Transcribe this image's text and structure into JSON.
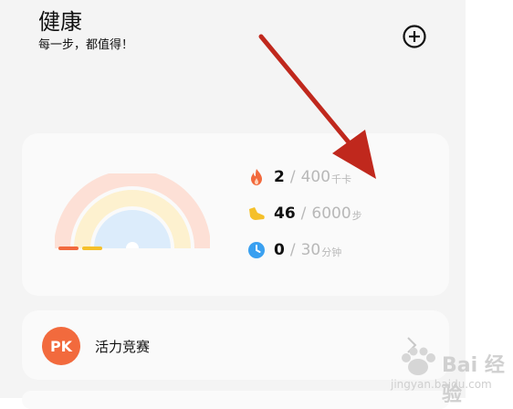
{
  "header": {
    "title": "健康",
    "subtitle": "每一步，都值得！"
  },
  "stats": [
    {
      "icon": "flame-icon",
      "value": "2",
      "separator": "/",
      "target": "400",
      "unit": "千卡",
      "color": "#f26a3d"
    },
    {
      "icon": "shoe-icon",
      "value": "46",
      "separator": "/",
      "target": "6000",
      "unit": "步",
      "color": "#f5c02a"
    },
    {
      "icon": "clock-icon",
      "value": "0",
      "separator": "/",
      "target": "30",
      "unit": "分钟",
      "color": "#3aa0f0"
    }
  ],
  "progress": {
    "calories_fraction": 0.005,
    "steps_fraction": 0.0077,
    "minutes_fraction": 0.0
  },
  "competition": {
    "badge": "PK",
    "label": "活力竞赛"
  },
  "watermark": {
    "main": "Bai 经验",
    "sub": "jingyan.baidu.com"
  },
  "colors": {
    "calories": "#f26a3d",
    "steps": "#f5c02a",
    "minutes": "#3aa0f0",
    "arrow": "#c0281d"
  }
}
